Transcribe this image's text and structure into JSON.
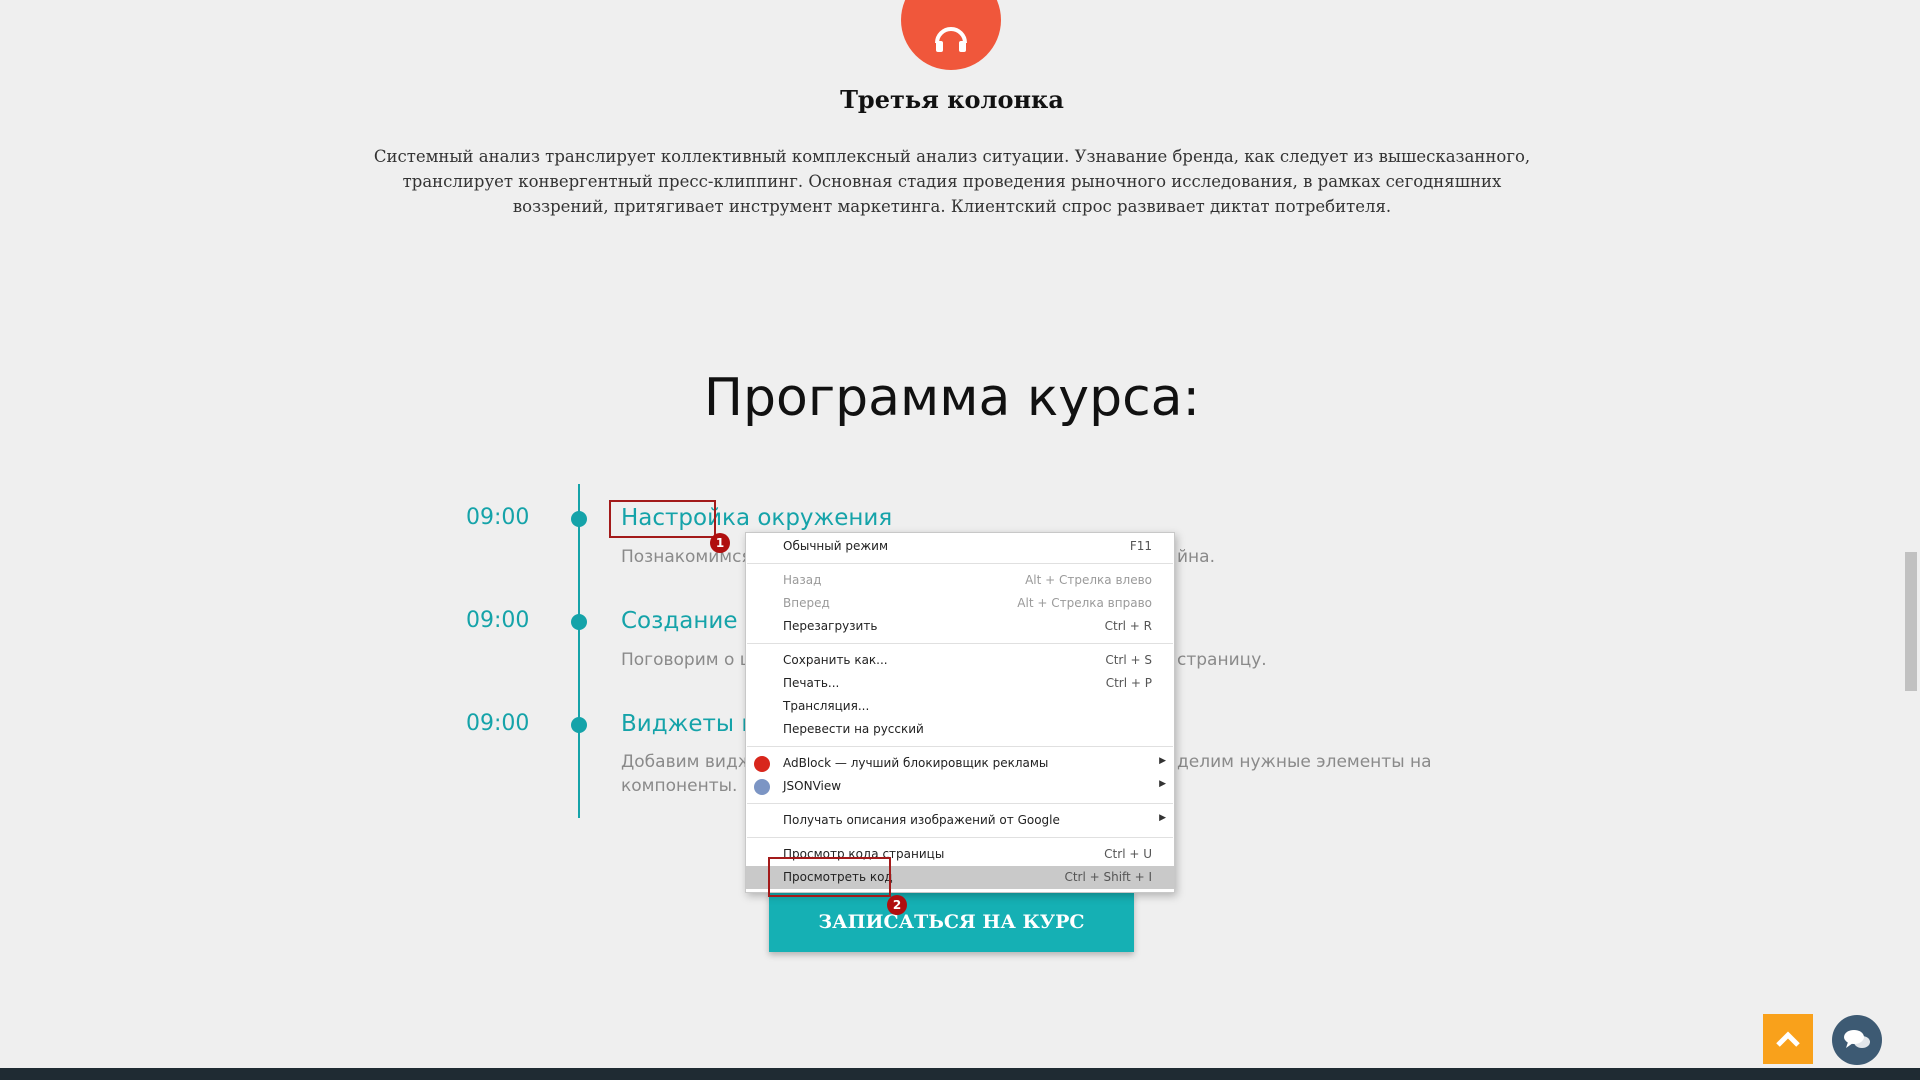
{
  "column": {
    "title": "Третья колонка",
    "text": "Системный анализ транслирует коллективный комплексный анализ ситуации. Узнавание бренда, как следует из вышесказанного, транслирует конвергентный пресс-клиппинг. Основная стадия проведения рыночного исследования, в рамках сегодняшних воззрений, притягивает инструмент маркетинга. Клиентский спрос развивает диктат потребителя.",
    "icon": "headphones-icon",
    "icon_color": "#f0573b"
  },
  "program": {
    "title": "Программа курса:",
    "items": [
      {
        "time": "09:00",
        "title": "Настройка окружения",
        "desc_left": "Познакомимся",
        "desc_right": "йна."
      },
      {
        "time": "09:00",
        "title": "Создание с",
        "desc_left": "Поговорим о ц",
        "desc_right": "страницу."
      },
      {
        "time": "09:00",
        "title": "Виджеты и",
        "desc_left": "Добавим видж",
        "desc_right": "делим нужные элементы на",
        "desc_line2": "компоненты."
      }
    ],
    "accent_color": "#15a3a9"
  },
  "cta": {
    "label": "ЗАПИСАТЬСЯ НА КУРС",
    "color": "#15b0b4"
  },
  "annotations": {
    "badge1": "1",
    "badge2": "2"
  },
  "context_menu": {
    "items": [
      {
        "label": "Обычный режим",
        "shortcut": "F11"
      },
      {
        "label": "Назад",
        "shortcut": "Alt + Стрелка влево",
        "disabled": true
      },
      {
        "label": "Вперед",
        "shortcut": "Alt + Стрелка вправо",
        "disabled": true
      },
      {
        "label": "Перезагрузить",
        "shortcut": "Ctrl + R"
      },
      {
        "label": "Сохранить как...",
        "shortcut": "Ctrl + S"
      },
      {
        "label": "Печать...",
        "shortcut": "Ctrl + P"
      },
      {
        "label": "Трансляция...",
        "shortcut": ""
      },
      {
        "label": "Перевести на русский",
        "shortcut": ""
      },
      {
        "label": "AdBlock — лучший блокировщик рекламы",
        "icon": "adblock-icon",
        "submenu": true
      },
      {
        "label": "JSONView",
        "icon": "jsonview-icon",
        "submenu": true
      },
      {
        "label": "Получать описания изображений от Google",
        "submenu": true
      },
      {
        "label": "Просмотр кода страницы",
        "shortcut": "Ctrl + U"
      },
      {
        "label": "Просмотреть код",
        "shortcut": "Ctrl + Shift + I",
        "highlighted": true
      }
    ]
  },
  "floating": {
    "scroll_top_icon": "chevron-up-icon",
    "scroll_top_color": "#f9a11b",
    "chat_icon": "chat-bubbles-icon",
    "chat_color": "#3d5a73"
  }
}
